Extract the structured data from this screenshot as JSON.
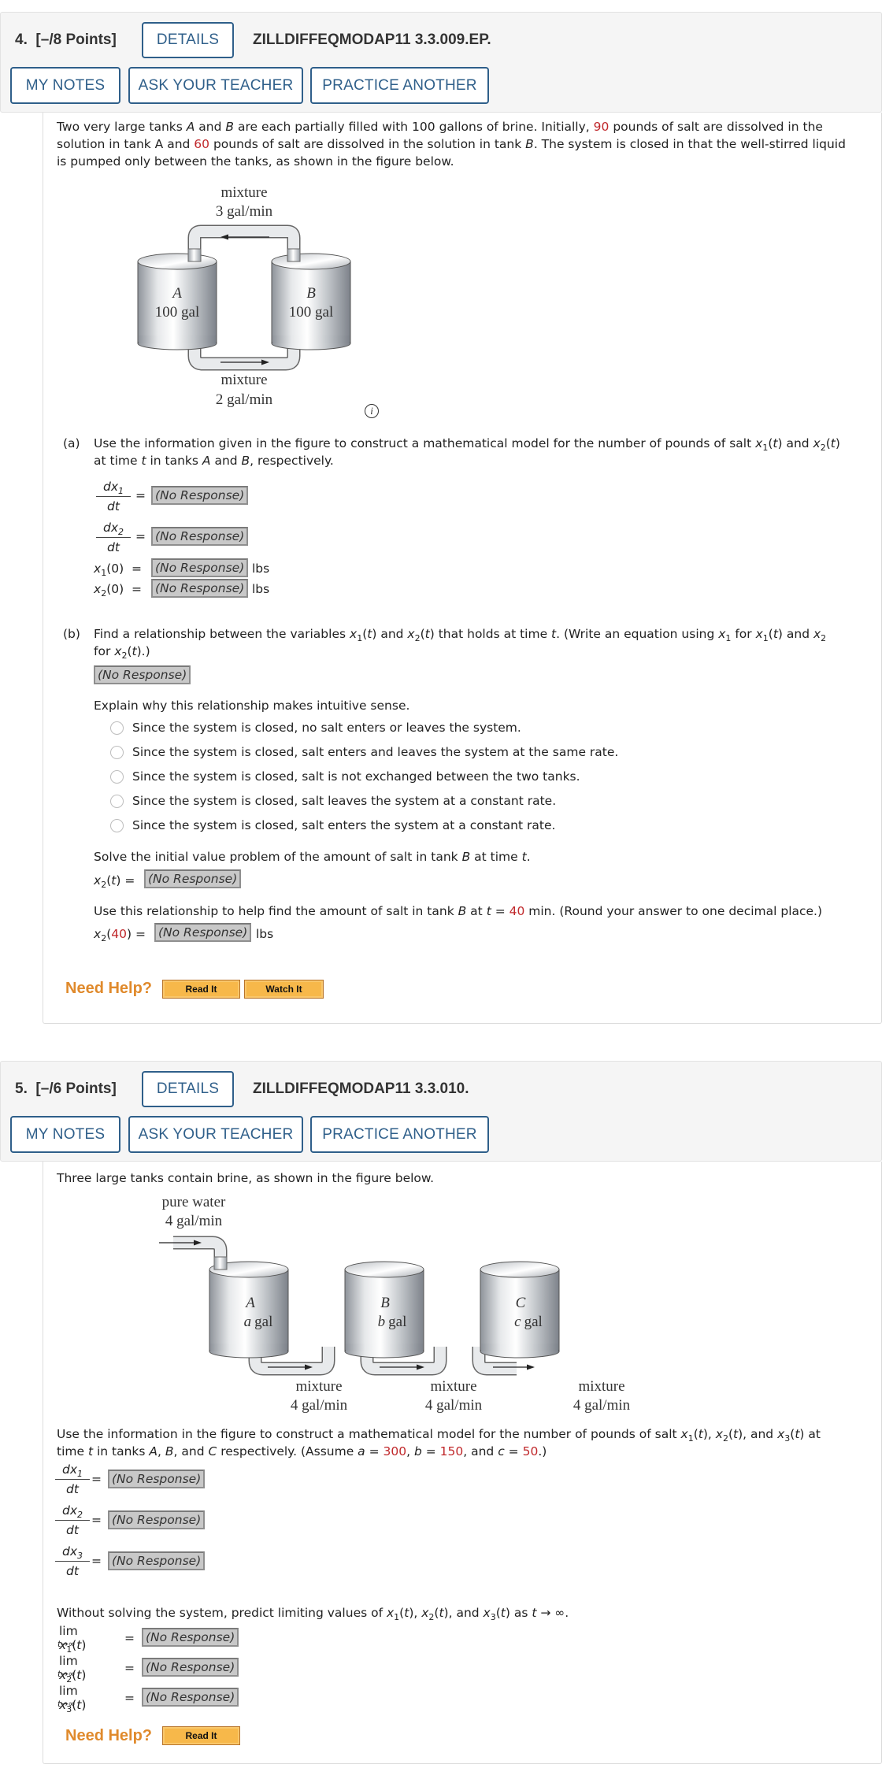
{
  "buttons": {
    "details": "DETAILS",
    "my_notes": "MY NOTES",
    "ask_teacher": "ASK YOUR TEACHER",
    "practice_another": "PRACTICE ANOTHER",
    "need_help": "Need Help?",
    "read_it": "Read It",
    "watch_it": "Watch It"
  },
  "no_response": "(No Response)",
  "q4": {
    "number": "4.",
    "points": "[–/8 Points]",
    "code": "ZILLDIFFEQMODAP11 3.3.009.EP.",
    "intro": {
      "p1": "Two very large tanks ",
      "A": "A",
      "p2": " and ",
      "B": "B",
      "p3": " are each partially filled with 100 gallons of brine. Initially, ",
      "salt_a": "90",
      "p4": " pounds of salt are dissolved in the",
      "p5": "solution in tank A and ",
      "salt_b": "60",
      "p6": " pounds of salt are dissolved in the solution in tank ",
      "p7": ". The system is closed in that the well-stirred liquid",
      "p8": "is pumped only between the tanks, as shown in the figure below."
    },
    "figure": {
      "top_flow_label": "mixture",
      "top_flow_rate": "3 gal/min",
      "bottom_flow_label": "mixture",
      "bottom_flow_rate": "2 gal/min",
      "tank_a_name": "A",
      "tank_a_volume": "100 gal",
      "tank_b_name": "B",
      "tank_b_volume": "100 gal",
      "info_icon": "i"
    },
    "part_a": {
      "label": "(a)",
      "line1": "Use the information given in the figure to construct a mathematical model for the number of pounds of salt ",
      "line1_end": " and ",
      "line2a": "at time ",
      "line2b": " in tanks ",
      "line2c": " and ",
      "line2d": ", respectively.",
      "dx1": "dx",
      "dx_sub1": "1",
      "dx_sub2": "2",
      "dt": "dt",
      "equals": "=",
      "x1_0": "(0)",
      "unit": "lbs"
    },
    "part_b": {
      "label": "(b)",
      "line1": "Find a relationship between the variables ",
      "and": " and ",
      "line1_mid": " that holds at time ",
      "line1_end": ". (Write an equation using ",
      "for": " for ",
      "line2_end": ".)",
      "explain": "Explain why this relationship makes intuitive sense.",
      "options": [
        "Since the system is closed, no salt enters or leaves the system.",
        "Since the system is closed, salt enters and leaves the system at the same rate.",
        "Since the system is closed, salt is not exchanged between the two tanks.",
        "Since the system is closed, salt leaves the system at a constant rate.",
        "Since the system is closed, salt enters the system at a constant rate."
      ],
      "solve": "Solve the initial value problem of the amount of salt in tank ",
      "at_time": " at time ",
      "use_rel_1": "Use this relationship to help find the amount of salt in tank ",
      "use_rel_2": " at ",
      "use_rel_t": "t",
      "use_rel_eq": " = ",
      "t_value": "40",
      "use_rel_3": " min. (Round your answer to one decimal place.)",
      "unit": "lbs"
    }
  },
  "q5": {
    "number": "5.",
    "points": "[–/6 Points]",
    "code": "ZILLDIFFEQMODAP11 3.3.010.",
    "intro": "Three large tanks contain brine, as shown in the figure below.",
    "figure": {
      "inflow_label": "pure water",
      "inflow_rate": "4 gal/min",
      "tanks": [
        {
          "name": "A",
          "var": "a",
          "unit": "gal"
        },
        {
          "name": "B",
          "var": "b",
          "unit": "gal"
        },
        {
          "name": "C",
          "var": "c",
          "unit": "gal"
        }
      ],
      "flows": [
        {
          "label": "mixture",
          "rate": "4 gal/min"
        },
        {
          "label": "mixture",
          "rate": "4 gal/min"
        },
        {
          "label": "mixture",
          "rate": "4 gal/min"
        }
      ]
    },
    "model": {
      "line1": "Use the information in the figure to construct a mathematical model for the number of pounds of salt ",
      "line1_end": " at",
      "line2a": "time ",
      "line2b": " in tanks ",
      "line2c": " respectively. (Assume ",
      "a_val": "300",
      "b_val": "150",
      "c_val": "50",
      "line2_end": ".)"
    },
    "limits": {
      "intro": "Without solving the system, predict limiting values of ",
      "intro_end": " as ",
      "lim": "lim",
      "sub": "t→∞"
    }
  }
}
